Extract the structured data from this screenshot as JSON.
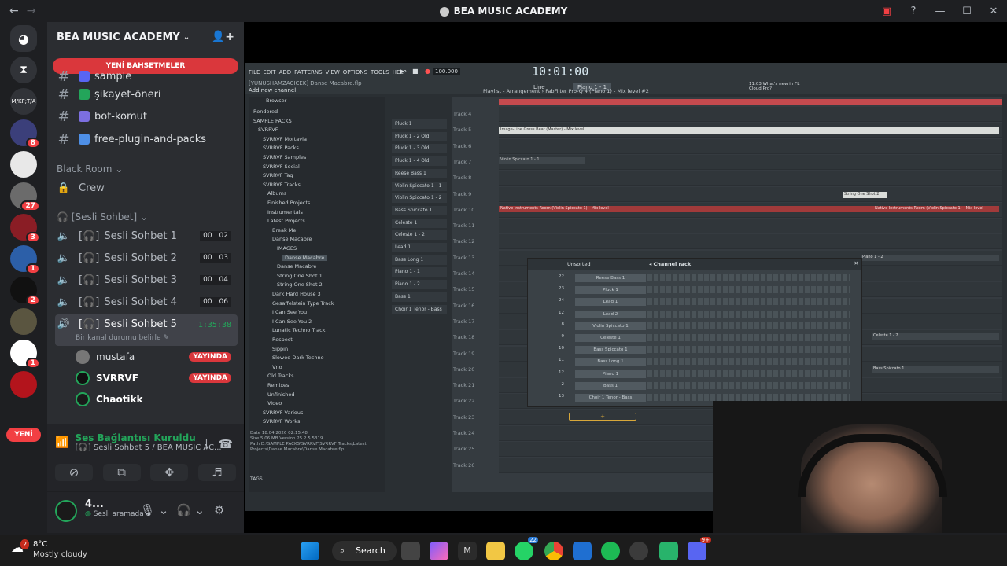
{
  "window": {
    "title": "BEA MUSIC ACADEMY"
  },
  "server": {
    "name": "BEA MUSIC ACADEMY",
    "new_mentions": "YENİ BAHSETMELER"
  },
  "guild_badges": [
    "8",
    "27",
    "3",
    "1",
    "2",
    "1"
  ],
  "guild_abbrev": "M/KF;T/A",
  "guild_new_label": "YENİ",
  "text_channels": [
    {
      "name": "sample",
      "emoji_color": "#5865f2"
    },
    {
      "name": "şikayet-öneri",
      "emoji_color": "#23a55a"
    },
    {
      "name": "bot-komut",
      "emoji_color": "#7c6fe0"
    },
    {
      "name": "free-plugin-and-packs",
      "emoji_color": "#4e8fe6"
    }
  ],
  "categories": {
    "black_room": "Black Room",
    "crew": "Crew",
    "voice": "[Sesli Sohbet]"
  },
  "voice_channels": [
    {
      "name": "Sesli Sohbet 1",
      "a": "00",
      "b": "02"
    },
    {
      "name": "Sesli Sohbet 2",
      "a": "00",
      "b": "03"
    },
    {
      "name": "Sesli Sohbet 3",
      "a": "00",
      "b": "04"
    },
    {
      "name": "Sesli Sohbet 4",
      "a": "00",
      "b": "06"
    }
  ],
  "active_voice": {
    "name": "Sesli Sohbet 5",
    "timer": "1:35:38",
    "status_prompt": "Bir kanal durumu belirle"
  },
  "members": [
    {
      "name": "mustafa",
      "live": "YAYINDA"
    },
    {
      "name": "SVRRVF",
      "live": "YAYINDA"
    },
    {
      "name": "Chaotikk",
      "live": ""
    }
  ],
  "voice_panel": {
    "status": "Ses Bağlantısı Kuruldu",
    "channel": "[🎧] Sesli Sohbet 5 / BEA MUSIC AC..."
  },
  "user_panel": {
    "name": "4...",
    "status": "Sesli aramada"
  },
  "fl": {
    "menu": [
      "FILE",
      "EDIT",
      "ADD",
      "PATTERNS",
      "VIEW",
      "OPTIONS",
      "TOOLS",
      "HELP"
    ],
    "bpm": "100.000",
    "time": "10:01:00",
    "pattern": "Piano 1 - 1",
    "snap": "Line",
    "project": "[YUNUSHAMZACICEK] Danse Macabre.flp",
    "add_channel": "Add new channel",
    "news": "11:03 What's new in FL Cloud Pro?",
    "playlist_title": "Playlist - Arrangement › FabFilter Pro-Q 4 (Piano 1) - Mix level #2",
    "browser_title": "Browser",
    "browser_items": [
      "Rendered",
      "SAMPLE PACKS",
      "SVRRVF",
      "SVRRVF Mortavia",
      "SVRRVF Packs",
      "SVRRVF Samples",
      "SVRRVF Social",
      "SVRRVF Tag",
      "SVRRVF Tracks",
      "Albums",
      "Finished Projects",
      "Instrumentals",
      "Latest Projects",
      "Break Me",
      "Danse Macabre",
      "IMAGES",
      "Danse Macabre",
      "Danse Macabre",
      "String One Shot 1",
      "String One Shot 2",
      "Dark Hard House 3",
      "Gesaffelstein Type Track",
      "I Can See You",
      "I Can See You 2",
      "Lunatic Techno Track",
      "Respect",
      "Sippin",
      "Slowed Dark Techno",
      "Vno",
      "Old Tracks",
      "Remixes",
      "Unfinished",
      "Video",
      "SVRRVF Various",
      "SVRRVF Works"
    ],
    "browser_info": [
      "18.04.2026 02:15:48",
      "5.06 MB   Version 25.2.5.5319",
      "D:\\SAMPLE PACKS\\SVRRVF\\SVRRVF Tracks\\Latest Projects\\Danse Macabre\\Danse Macabre.flp"
    ],
    "browser_info_labels": [
      "Date",
      "Size",
      "Path"
    ],
    "tags_label": "TAGS",
    "channels": [
      "Pluck 1",
      "Pluck 1 - 2 Old",
      "Pluck 1 - 3 Old",
      "Pluck 1 - 4 Old",
      "Reese Bass 1",
      "Violin Spiccato 1 - 1",
      "Violin Spiccato 1 - 2",
      "Bass Spiccato 1",
      "Celeste 1",
      "Celeste 1 - 2",
      "Lead 1",
      "Bass Long 1",
      "Piano 1 - 1",
      "Piano 1 - 2",
      "Bass 1",
      "Choir 1 Tenor - Bass"
    ],
    "tracks": [
      "Track 4",
      "Track 5",
      "Track 6",
      "Track 7",
      "Track 8",
      "Track 9",
      "Track 10",
      "Track 11",
      "Track 12",
      "Track 13",
      "Track 14",
      "Track 15",
      "Track 16",
      "Track 17",
      "Track 18",
      "Track 19",
      "Track 20",
      "Track 21",
      "Track 22",
      "Track 23",
      "Track 24",
      "Track 25",
      "Track 26"
    ],
    "clips": {
      "image_line": "Image-Line Gross Beat (Master) - Mix level",
      "violin": "Violin Spiccato 1 - 1",
      "native": "Native Instruments Room (Violin Spiccato 1) - Mix level",
      "native2": "Native Instruments Room (Violin Spiccato 1) - Mix level",
      "string": "String One Shot 2",
      "piano": "Piano 1 - 2",
      "celeste": "Celeste 1 - 2",
      "bass": "Bass Spiccato 1"
    },
    "rack": {
      "title": "Channel rack",
      "filter": "Unsorted",
      "rows": [
        {
          "num": "22",
          "name": "Reese Bass 1"
        },
        {
          "num": "23",
          "name": "Pluck 1"
        },
        {
          "num": "24",
          "name": "Lead 1"
        },
        {
          "num": "12",
          "name": "Lead 2"
        },
        {
          "num": "8",
          "name": "Violin Spiccato 1"
        },
        {
          "num": "9",
          "name": "Celeste 1"
        },
        {
          "num": "10",
          "name": "Bass Spiccato 1"
        },
        {
          "num": "11",
          "name": "Bass Long 1"
        },
        {
          "num": "12",
          "name": "Piano 1"
        },
        {
          "num": "2",
          "name": "Bass 1"
        },
        {
          "num": "13",
          "name": "Choir 1 Tenor - Bass"
        }
      ]
    }
  },
  "taskbar": {
    "temp": "8°C",
    "weather": "Mostly cloudy",
    "search": "Search",
    "weather_badge": "2",
    "whatsapp_badge": "22",
    "discord_badge": "9+"
  }
}
